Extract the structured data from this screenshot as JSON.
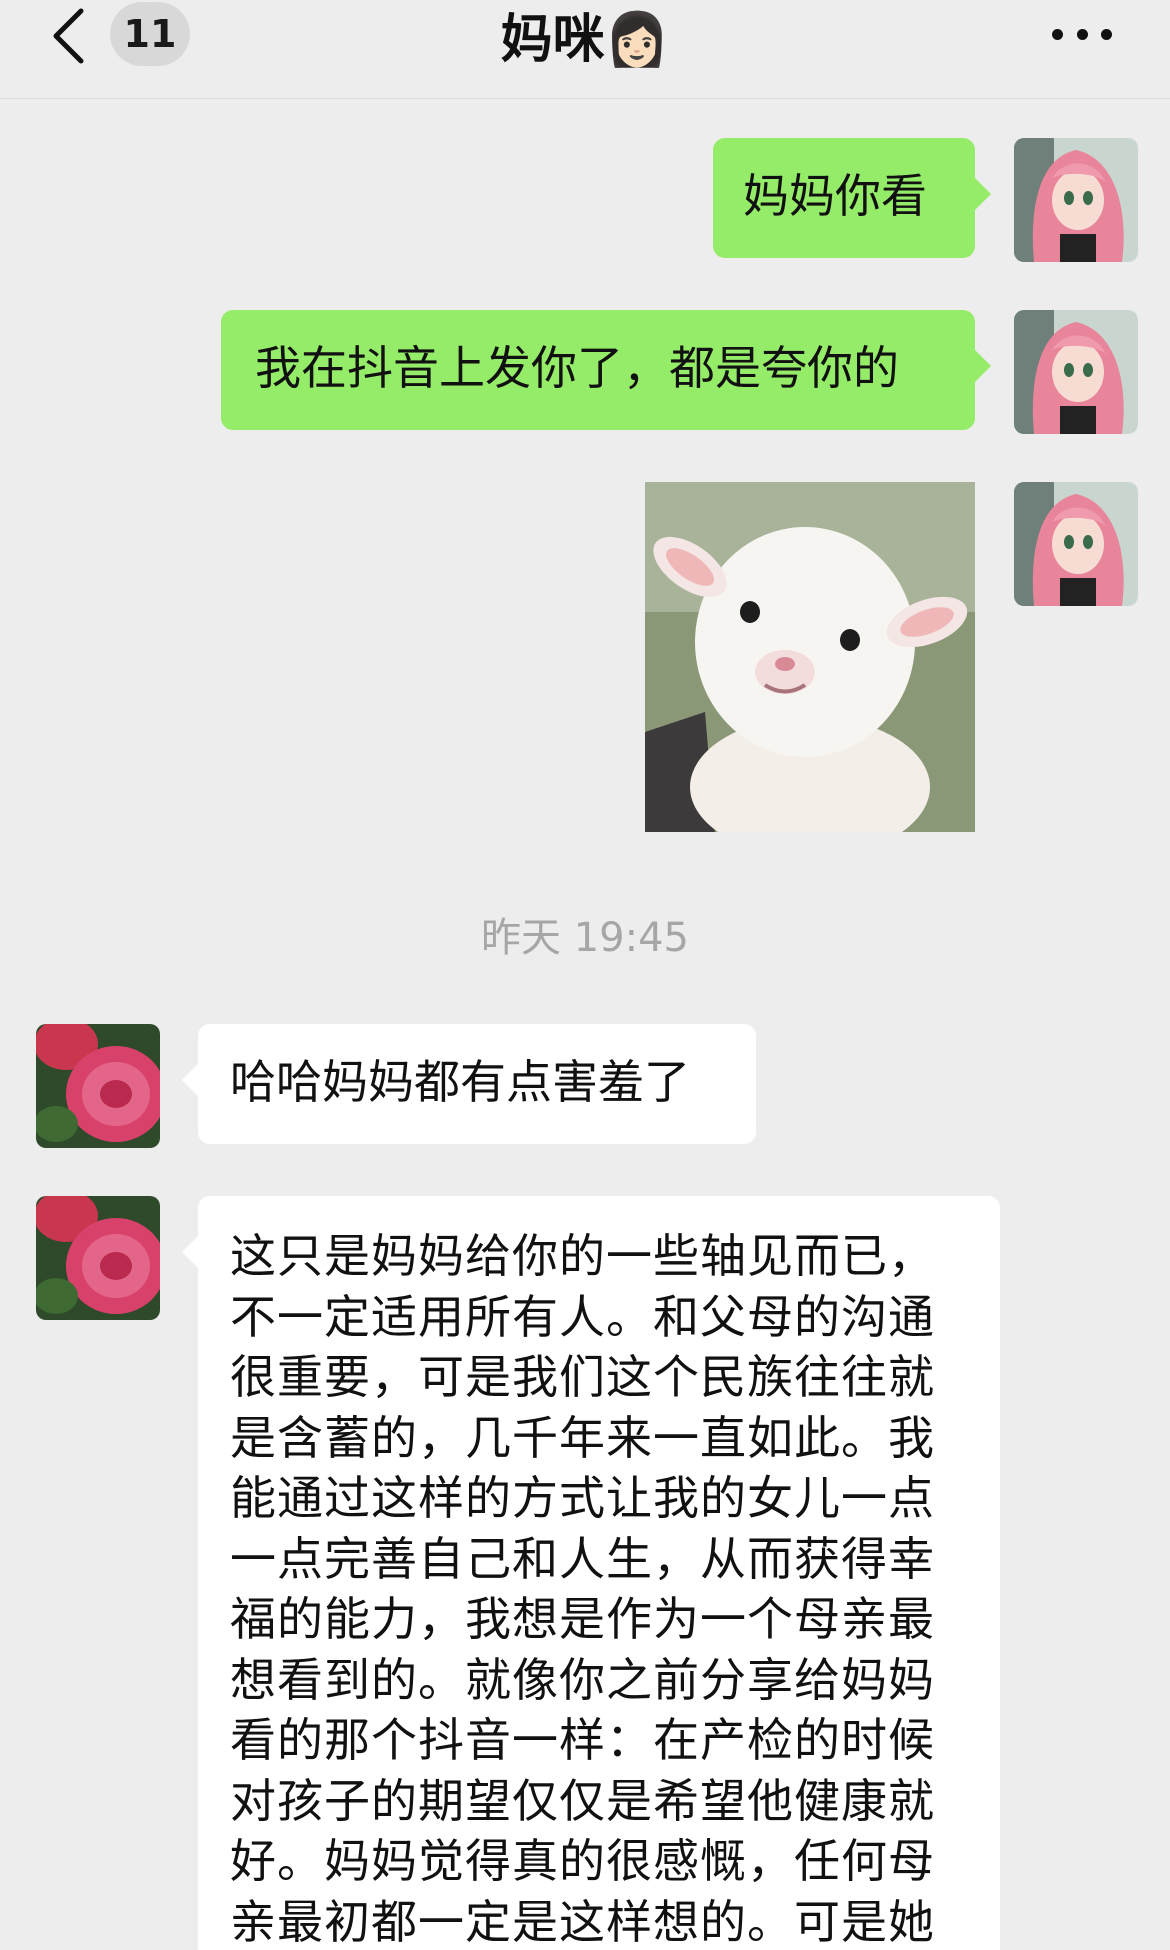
{
  "header": {
    "back_icon": "chevron-left-icon",
    "unread_count": "11",
    "title": "妈咪👩🏻",
    "more_icon": "more-dots-icon"
  },
  "messages": [
    {
      "direction": "sent",
      "type": "text",
      "text": "妈妈你看"
    },
    {
      "direction": "sent",
      "type": "text",
      "text": "我在抖音上发你了，都是夸你的"
    },
    {
      "direction": "sent",
      "type": "image",
      "image_subject": "smiling white lamb"
    },
    {
      "type": "timestamp",
      "text": "昨天 19:45"
    },
    {
      "direction": "received",
      "type": "text",
      "text": "哈哈妈妈都有点害羞了"
    },
    {
      "direction": "received",
      "type": "text",
      "text": "这只是妈妈给你的一些轴见而已，不一定适用所有人。和父母的沟通很重要，可是我们这个民族往往就是含蓄的，几千年来一直如此。我能通过这样的方式让我的女儿一点一点完善自己和人生，从而获得幸福的能力，我想是作为一个母亲最想看到的。就像你之前分享给妈妈看的那个抖音一样：在产检的时候对孩子的期望仅仅是希望他健康就好。妈妈觉得真的很感慨，任何母亲最初都一定是这样想的。可是她"
    }
  ],
  "colors": {
    "background": "#ededed",
    "sent_bubble": "#95ec69",
    "received_bubble": "#ffffff",
    "timestamp_text": "#a6a6a6"
  }
}
